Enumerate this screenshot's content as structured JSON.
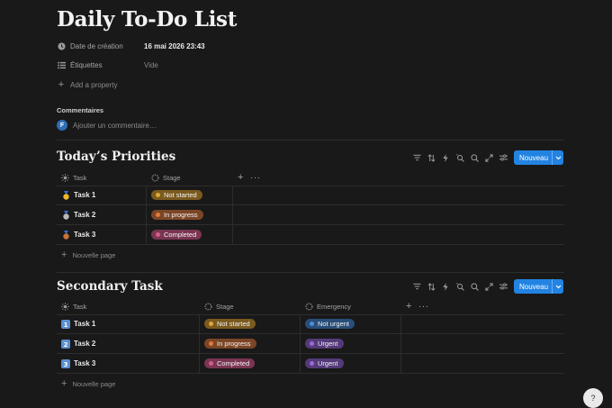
{
  "page": {
    "title": "Daily To-Do List"
  },
  "properties": {
    "created": {
      "icon": "clock-icon",
      "label": "Date de création",
      "value": "16 mai 2026 23:43"
    },
    "tags": {
      "icon": "list-icon",
      "label": "Étiquettes",
      "value": "Vide"
    },
    "add_property": "Add a property"
  },
  "comments": {
    "label": "Commentaires",
    "avatar_initial": "F",
    "placeholder": "Ajouter un commentaire…"
  },
  "sections": [
    {
      "title": "Today’s Priorities",
      "new_button": "Nouveau",
      "columns": [
        {
          "label": "Task",
          "icon": "sun-icon"
        },
        {
          "label": "Stage",
          "icon": "status-icon"
        }
      ],
      "rows": [
        {
          "icon": "gold-medal-icon",
          "name": "Task 1",
          "stage": "Not started"
        },
        {
          "icon": "silver-medal-icon",
          "name": "Task 2",
          "stage": "In progress"
        },
        {
          "icon": "bronze-medal-icon",
          "name": "Task 3",
          "stage": "Completed"
        }
      ],
      "new_page": "Nouvelle page"
    },
    {
      "title": "Secondary Task",
      "new_button": "Nouveau",
      "columns": [
        {
          "label": "Task",
          "icon": "sun-icon"
        },
        {
          "label": "Stage",
          "icon": "status-icon"
        },
        {
          "label": "Emergency",
          "icon": "status-icon"
        }
      ],
      "rows": [
        {
          "icon": "keycap-1-icon",
          "name": "Task 1",
          "stage": "Not started",
          "emergency": "Not urgent"
        },
        {
          "icon": "keycap-2-icon",
          "name": "Task 2",
          "stage": "In progress",
          "emergency": "Urgent"
        },
        {
          "icon": "keycap-3-icon",
          "name": "Task 3",
          "stage": "Completed",
          "emergency": "Urgent"
        }
      ],
      "new_page": "Nouvelle page"
    }
  ],
  "colors": {
    "background": "#191919",
    "accent": "#2383e2",
    "not_started": "#e0a73a",
    "in_progress": "#e07b3c",
    "completed": "#d45c8c",
    "not_urgent": "#4d8ed8",
    "urgent": "#9a6bd4"
  },
  "help_button": "?"
}
